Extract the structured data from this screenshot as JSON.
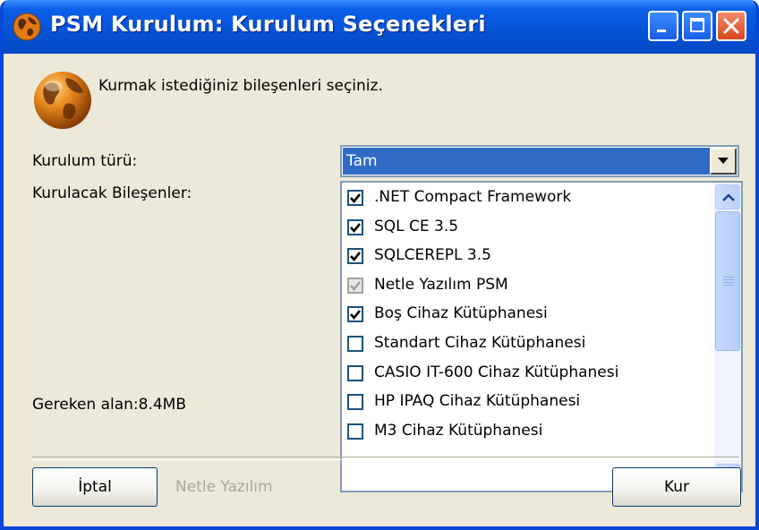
{
  "window": {
    "title": "PSM Kurulum: Kurulum Seçenekleri"
  },
  "header": {
    "instruction": "Kurmak istediğiniz bileşenleri seçiniz."
  },
  "install_type": {
    "label": "Kurulum türü:",
    "value": "Tam"
  },
  "components": {
    "label": "Kurulacak Bileşenler:",
    "items": [
      {
        "label": ".NET Compact Framework",
        "checked": true,
        "disabled": false
      },
      {
        "label": "SQL CE 3.5",
        "checked": true,
        "disabled": false
      },
      {
        "label": "SQLCEREPL 3.5",
        "checked": true,
        "disabled": false
      },
      {
        "label": "Netle Yazılım PSM",
        "checked": true,
        "disabled": true
      },
      {
        "label": "Boş Cihaz Kütüphanesi",
        "checked": true,
        "disabled": false
      },
      {
        "label": "Standart Cihaz Kütüphanesi",
        "checked": false,
        "disabled": false
      },
      {
        "label": "CASIO IT-600 Cihaz Kütüphanesi",
        "checked": false,
        "disabled": false
      },
      {
        "label": "HP IPAQ Cihaz Kütüphanesi",
        "checked": false,
        "disabled": false
      },
      {
        "label": "M3 Cihaz Kütüphanesi",
        "checked": false,
        "disabled": false
      }
    ]
  },
  "required_space": {
    "text": "Gereken alan:8.4MB"
  },
  "footer": {
    "cancel_label": "İptal",
    "brand": "Netle Yazılım",
    "install_label": "Kur"
  },
  "colors": {
    "titlebar": "#0453d4",
    "selection": "#316ac5",
    "dialog_bg": "#ece9d8",
    "close_button": "#d8461e"
  },
  "icons": {
    "app": "globe-icon",
    "minimize": "minimize-icon",
    "maximize": "maximize-icon",
    "close": "close-icon",
    "dropdown": "chevron-down-icon",
    "scroll_up": "chevron-up-icon",
    "scroll_down": "chevron-down-icon"
  }
}
